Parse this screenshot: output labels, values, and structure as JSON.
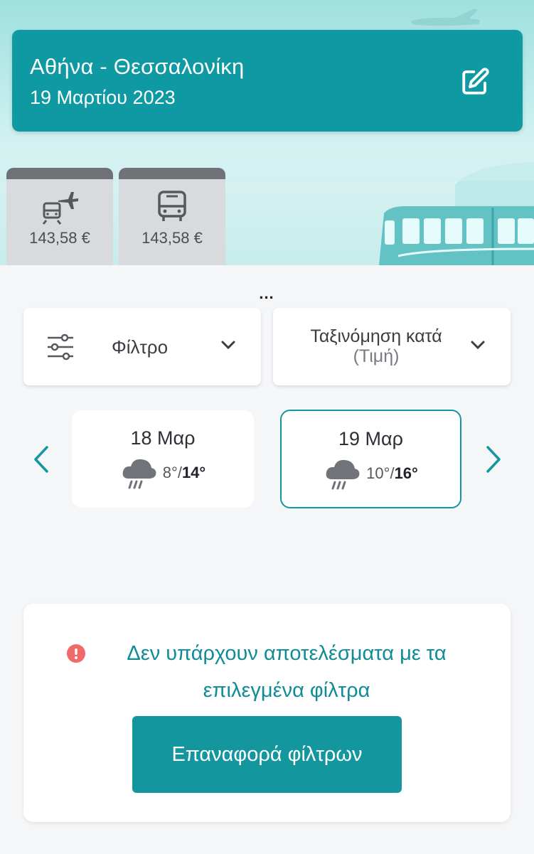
{
  "route": {
    "title": "Αθήνα - Θεσσαλονίκη",
    "date": "19 Μαρτίου 2023"
  },
  "icons": {
    "edit": "edit-icon",
    "train_plane": "train-plane-icon",
    "bus": "bus-icon",
    "filter": "sliders-icon",
    "chevron": "chevron-down-icon",
    "prev": "chevron-left-icon",
    "next": "chevron-right-icon",
    "weather": "rain-cloud-icon",
    "alert": "alert-circle-icon"
  },
  "modes": [
    {
      "price": "143,58 €"
    },
    {
      "price": "143,58 €"
    }
  ],
  "more": "...",
  "controls": {
    "filter_label": "Φίλτρο",
    "sort_label": "Ταξινόμηση κατά",
    "sort_value": "(Τιμή)"
  },
  "days": [
    {
      "label": "18 Μαρ",
      "low": "8°",
      "high": "14°",
      "selected": false
    },
    {
      "label": "19 Μαρ",
      "low": "10°",
      "high": "16°",
      "selected": true
    }
  ],
  "empty": {
    "message": "Δεν υπάρχουν αποτελέσματα με τα επιλεγμένα φίλτρα",
    "reset_label": "Επαναφορά φίλτρων"
  },
  "colors": {
    "primary": "#13969e",
    "header": "#0f9aa3",
    "alert": "#f06a6a"
  }
}
